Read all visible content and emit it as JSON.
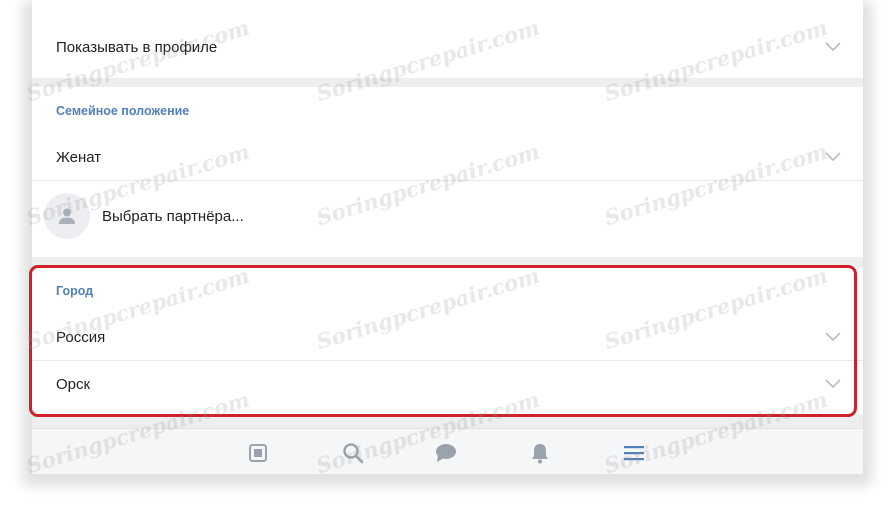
{
  "profile_visibility": {
    "label": "Показывать в профиле"
  },
  "marital": {
    "section_title": "Семейное положение",
    "value": "Женат",
    "partner_label": "Выбрать партнёра..."
  },
  "city": {
    "section_title": "Город",
    "country": "Россия",
    "city": "Орск"
  },
  "tabbar": {
    "items": [
      "news-icon",
      "search-icon",
      "messages-icon",
      "notifications-icon",
      "menu-icon"
    ],
    "active": "menu-icon"
  },
  "watermark": "Soringpcrepair.com",
  "colors": {
    "accent": "#5181b8",
    "highlight": "#d0202a",
    "text": "#222222"
  }
}
